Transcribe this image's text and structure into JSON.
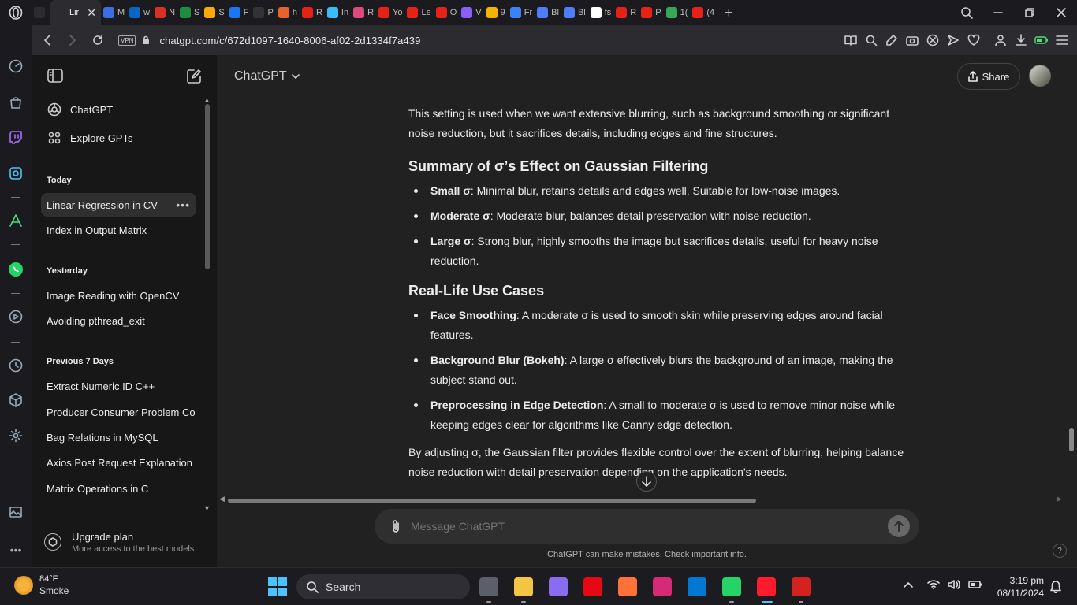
{
  "browser": {
    "tabs": [
      {
        "title": "",
        "icon": "gamepad-icon",
        "color": "#2b2b30"
      },
      {
        "title": "Lir",
        "icon": "chatgpt-icon",
        "color": "#2b2b30",
        "active": true
      },
      {
        "title": "M",
        "icon": "opera-icon",
        "color": "#3b6fe0"
      },
      {
        "title": "w",
        "icon": "linkedin-icon",
        "color": "#0a66c2"
      },
      {
        "title": "N",
        "icon": "gmail-icon",
        "color": "#d93025"
      },
      {
        "title": "S",
        "icon": "classroom-icon",
        "color": "#1e8e3e"
      },
      {
        "title": "S",
        "icon": "classroom-icon",
        "color": "#f9ab00"
      },
      {
        "title": "F",
        "icon": "facebook-icon",
        "color": "#1877f2"
      },
      {
        "title": "P",
        "icon": "github-icon",
        "color": "#333333"
      },
      {
        "title": "h",
        "icon": "app-icon",
        "color": "#e8622c"
      },
      {
        "title": "R",
        "icon": "youtube-icon",
        "color": "#e62117"
      },
      {
        "title": "In",
        "icon": "tailwind-icon",
        "color": "#38bdf8"
      },
      {
        "title": "R",
        "icon": "react-icon",
        "color": "#e04a7a"
      },
      {
        "title": "Yo",
        "icon": "youtube-icon",
        "color": "#e62117"
      },
      {
        "title": "Le",
        "icon": "youtube-icon",
        "color": "#e62117"
      },
      {
        "title": "O",
        "icon": "youtube-icon",
        "color": "#e62117"
      },
      {
        "title": "V",
        "icon": "vite-icon",
        "color": "#8b5cf6"
      },
      {
        "title": "9",
        "icon": "drive-icon",
        "color": "#f4b400"
      },
      {
        "title": "Fr",
        "icon": "app-icon",
        "color": "#3b82f6"
      },
      {
        "title": "Bl",
        "icon": "app-icon",
        "color": "#4f7cf7"
      },
      {
        "title": "Bl",
        "icon": "app-icon",
        "color": "#4f7cf7"
      },
      {
        "title": "fs",
        "icon": "google-icon",
        "color": "#ffffff"
      },
      {
        "title": "R",
        "icon": "youtube-icon",
        "color": "#e62117"
      },
      {
        "title": "P",
        "icon": "youtube-icon",
        "color": "#e62117"
      },
      {
        "title": "1(",
        "icon": "drive-icon",
        "color": "#34a853"
      },
      {
        "title": "(4",
        "icon": "youtube-icon",
        "color": "#e62117"
      }
    ],
    "url": "chatgpt.com/c/672d1097-1640-8006-af02-2d1334f7a439",
    "vpn_label": "VPN"
  },
  "sidebar": {
    "nav": [
      {
        "label": "ChatGPT",
        "icon": "chatgpt-logo-icon"
      },
      {
        "label": "Explore GPTs",
        "icon": "grid-icon"
      }
    ],
    "groups": [
      {
        "heading": "Today",
        "items": [
          "Linear Regression in CV",
          "Index in Output Matrix"
        ]
      },
      {
        "heading": "Yesterday",
        "items": [
          "Image Reading with OpenCV",
          "Avoiding pthread_exit"
        ]
      },
      {
        "heading": "Previous 7 Days",
        "items": [
          "Extract Numeric ID C++",
          "Producer Consumer Problem Co",
          "Bag Relations in MySQL",
          "Axios Post Request Explanation",
          "Matrix Operations in C"
        ]
      }
    ],
    "upgrade": {
      "title": "Upgrade plan",
      "subtitle": "More access to the best models"
    }
  },
  "header": {
    "model": "ChatGPT",
    "share_label": "Share"
  },
  "content": {
    "intro": "This setting is used when we want extensive blurring, such as background smoothing or significant noise reduction, but it sacrifices details, including edges and fine structures.",
    "section1": {
      "title": "Summary of σ’s Effect on Gaussian Filtering",
      "items": [
        {
          "term": "Small σ",
          "text": ": Minimal blur, retains details and edges well. Suitable for low-noise images."
        },
        {
          "term": "Moderate σ",
          "text": ": Moderate blur, balances detail preservation with noise reduction."
        },
        {
          "term": "Large σ",
          "text": ": Strong blur, highly smooths the image but sacrifices details, useful for heavy noise reduction."
        }
      ]
    },
    "section2": {
      "title": "Real-Life Use Cases",
      "items": [
        {
          "term": "Face Smoothing",
          "text": ": A moderate σ is used to smooth skin while preserving edges around facial features."
        },
        {
          "term": "Background Blur (Bokeh)",
          "text": ": A large σ effectively blurs the background of an image, making the subject stand out."
        },
        {
          "term": "Preprocessing in Edge Detection",
          "text": ": A small to moderate σ is used to remove minor noise while keeping edges clear for algorithms like Canny edge detection."
        }
      ]
    },
    "outro": "By adjusting σ, the Gaussian filter provides flexible control over the extent of blurring, helping balance noise reduction with detail preservation depending on the application's needs."
  },
  "composer": {
    "placeholder": "Message ChatGPT",
    "disclaimer": "ChatGPT can make mistakes. Check important info.",
    "help": "?"
  },
  "taskbar": {
    "weather": {
      "temp": "84°F",
      "condition": "Smoke"
    },
    "search_label": "Search",
    "apps": [
      {
        "name": "task-view-icon",
        "color": "#5a5f6a"
      },
      {
        "name": "file-explorer-icon",
        "color": "#f4c542"
      },
      {
        "name": "copilot-icon",
        "color": "#8a6cf0"
      },
      {
        "name": "netflix-icon",
        "color": "#e50914"
      },
      {
        "name": "firefox-icon",
        "color": "#ff7139"
      },
      {
        "name": "instagram-icon",
        "color": "#d62976"
      },
      {
        "name": "vscode-icon",
        "color": "#0078d4"
      },
      {
        "name": "whatsapp-icon",
        "color": "#25d366"
      },
      {
        "name": "opera-icon",
        "color": "#ff1b2d"
      },
      {
        "name": "acrobat-icon",
        "color": "#d4231e"
      }
    ],
    "time": "3:19 pm",
    "date": "08/11/2024"
  }
}
